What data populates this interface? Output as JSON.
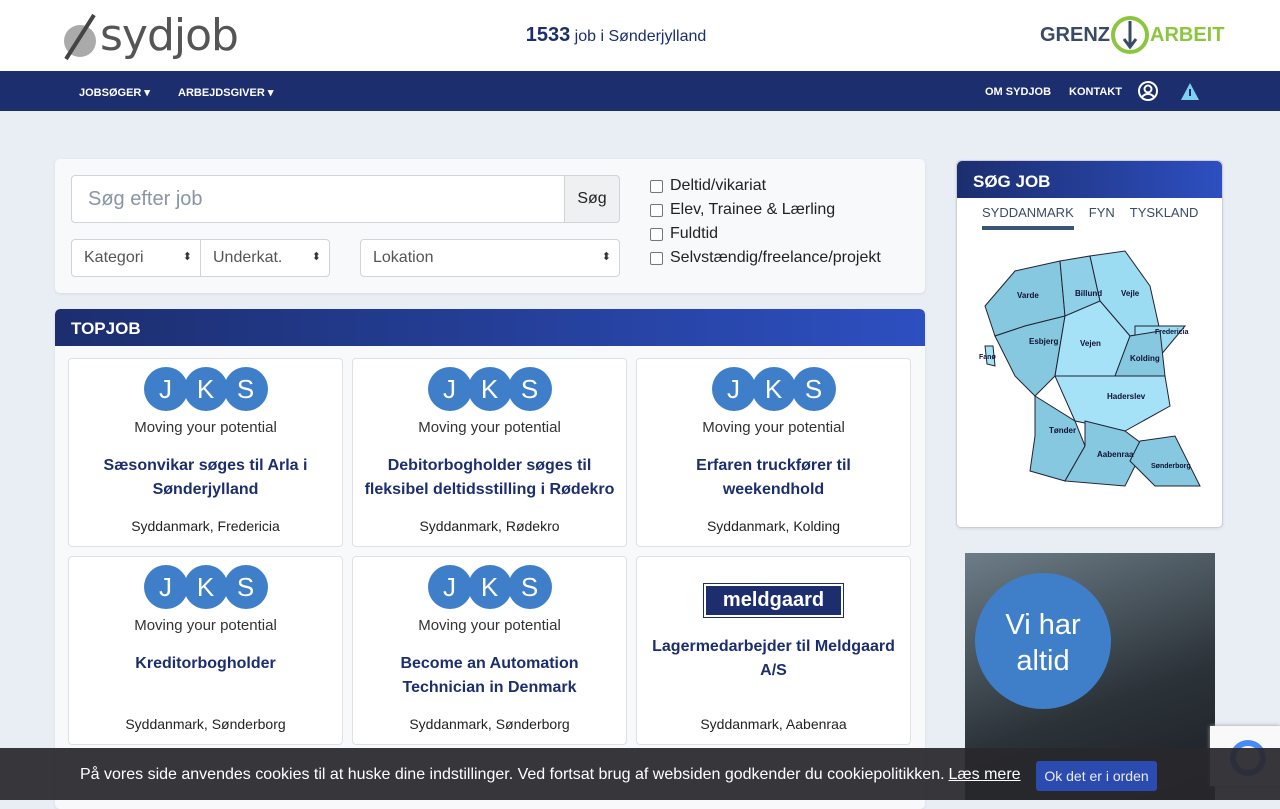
{
  "header": {
    "logo": "sydjob",
    "count": "1533",
    "count_suffix": "job i Sønderjylland",
    "partner_left": "GRENZ",
    "partner_right": "ARBEIT"
  },
  "nav": {
    "left": [
      "JOBSØGER",
      "ARBEJDSGIVER"
    ],
    "right": [
      "OM SYDJOB",
      "KONTAKT"
    ]
  },
  "search": {
    "placeholder": "Søg efter job",
    "button": "Søg",
    "category": "Kategori",
    "subcategory": "Underkat.",
    "location": "Lokation",
    "filters": [
      "Deltid/vikariat",
      "Elev, Trainee & Lærling",
      "Fuldtid",
      "Selvstændig/freelance/projekt"
    ]
  },
  "topjob": {
    "title": "TOPJOB",
    "jobs": [
      {
        "logo": "JKS",
        "tagline": "Moving your potential",
        "title": "Sæsonvikar søges til Arla i Sønderjylland",
        "location": "Syddanmark, Fredericia"
      },
      {
        "logo": "JKS",
        "tagline": "Moving your potential",
        "title": "Debitorbogholder søges til fleksibel deltidsstilling i Rødekro",
        "location": "Syddanmark, Rødekro"
      },
      {
        "logo": "JKS",
        "tagline": "Moving your potential",
        "title": "Erfaren truckfører til weekendhold",
        "location": "Syddanmark, Kolding"
      },
      {
        "logo": "JKS",
        "tagline": "Moving your potential",
        "title": "Kreditorbogholder",
        "location": "Syddanmark, Sønderborg"
      },
      {
        "logo": "JKS",
        "tagline": "Moving your potential",
        "title": "Become an Automation Technician in Denmark",
        "location": "Syddanmark, Sønderborg"
      },
      {
        "logo": "meldgaard",
        "title": "Lagermedarbejder til Meldgaard A/S",
        "location": "Syddanmark, Aabenraa"
      }
    ]
  },
  "sidebar": {
    "title": "SØG JOB",
    "tabs": [
      "SYDDANMARK",
      "FYN",
      "TYSKLAND"
    ],
    "regions": [
      "Varde",
      "Billund",
      "Vejle",
      "Fredericia",
      "Fanø",
      "Esbjerg",
      "Vejen",
      "Kolding",
      "Haderslev",
      "Tønder",
      "Aabenraa",
      "Sønderborg"
    ]
  },
  "ad": {
    "text": "Vi har altid"
  },
  "cookie": {
    "message": "På vores side anvendes cookies til at huske dine indstillinger. Ved fortsat brug af websiden godkender du cookiepolitikken.",
    "link": "Læs mere",
    "button": "Ok det er i orden"
  }
}
